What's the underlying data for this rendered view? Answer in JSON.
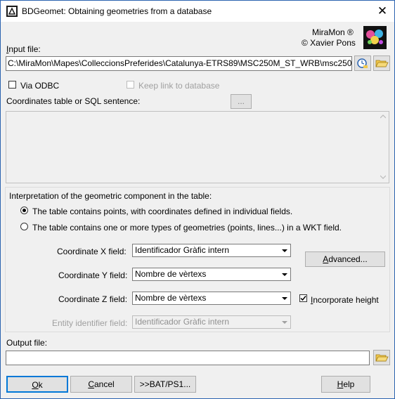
{
  "window": {
    "title": "BDGeomet: Obtaining geometries from a database",
    "close_glyph": "✕"
  },
  "branding": {
    "line1": "MiraMon ®",
    "line2": "© Xavier Pons"
  },
  "input_file": {
    "label": "Input file:",
    "value": "C:\\MiraMon\\Mapes\\ColleccionsPreferides\\Catalunya-ETRS89\\MSC250M_ST_WRB\\msc250"
  },
  "options": {
    "via_odbc": "Via ODBC",
    "keep_link": "Keep link to database"
  },
  "coordinates": {
    "label": "Coordinates table or SQL sentence:",
    "browse_label": "..."
  },
  "interpretation": {
    "heading": "Interpretation of the geometric component in the table:",
    "radio_points": "The table contains points, with coordinates defined in individual fields.",
    "radio_wkt": "The table contains one or more types of geometries (points, lines...) in a WKT field."
  },
  "fields": {
    "x_label": "Coordinate X field:",
    "x_value": "Identificador Gràfic intern",
    "y_label": "Coordinate Y field:",
    "y_value": "Nombre de vèrtexs",
    "z_label": "Coordinate Z field:",
    "z_value": "Nombre de vèrtexs",
    "entity_label": "Entity identifier field:",
    "entity_value": "Identificador Gràfic intern",
    "advanced": "Advanced...",
    "incorporate_height": "Incorporate height"
  },
  "output_file": {
    "label": "Output file:",
    "value": ""
  },
  "buttons": {
    "ok": "Ok",
    "cancel": "Cancel",
    "bat": ">>BAT/PS1...",
    "help": "Help"
  },
  "colors": {
    "accent": "#2b63b0",
    "folder": "#f2c94c"
  }
}
